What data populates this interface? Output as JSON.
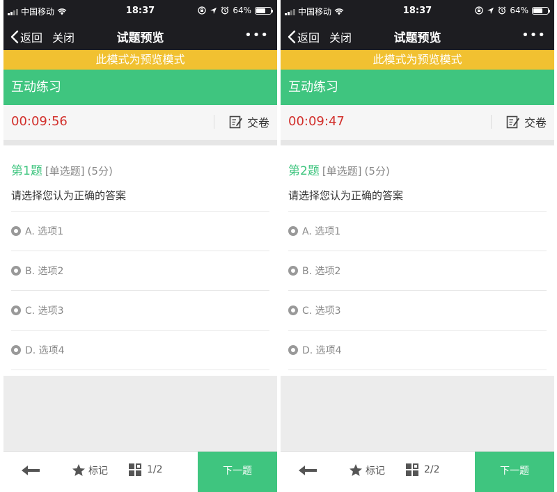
{
  "phones": [
    {
      "status": {
        "carrier": "中国移动",
        "time": "18:37",
        "battery": "64%",
        "battery_level": 0.64
      },
      "nav": {
        "back": "返回",
        "close": "关闭",
        "title": "试题预览",
        "more": "•••"
      },
      "banner": "此模式为预览模式",
      "section": "互动练习",
      "timer": "00:09:56",
      "submit": "交卷",
      "question": {
        "number": "第1题",
        "type": "[单选题]",
        "score": "(5分)",
        "text": "请选择您认为正确的答案",
        "options": [
          "A. 选项1",
          "B. 选项2",
          "C. 选项3",
          "D. 选项4"
        ]
      },
      "bottom": {
        "mark": "标记",
        "progress": "1/2",
        "next": "下一题"
      }
    },
    {
      "status": {
        "carrier": "中国移动",
        "time": "18:37",
        "battery": "64%",
        "battery_level": 0.64
      },
      "nav": {
        "back": "返回",
        "close": "关闭",
        "title": "试题预览",
        "more": "•••"
      },
      "banner": "此模式为预览模式",
      "section": "互动练习",
      "timer": "00:09:47",
      "submit": "交卷",
      "question": {
        "number": "第2题",
        "type": "[单选题]",
        "score": "(5分)",
        "text": "请选择您认为正确的答案",
        "options": [
          "A. 选项1",
          "B. 选项2",
          "C. 选项3",
          "D. 选项4"
        ]
      },
      "bottom": {
        "mark": "标记",
        "progress": "2/2",
        "next": "下一题"
      }
    }
  ],
  "colors": {
    "accent_green": "#3fc57f",
    "banner_yellow": "#f1c131",
    "timer_red": "#d2302c",
    "navbar_dark": "#1d1d21"
  },
  "icons": {
    "back": "chevron-left-icon",
    "wifi": "wifi-icon",
    "location": "location-arrow-icon",
    "alarm": "alarm-icon",
    "lock": "rotation-lock-icon",
    "submit": "edit-note-icon",
    "star": "star-icon",
    "grid": "answer-card-icon",
    "arrow": "arrow-left-icon"
  }
}
